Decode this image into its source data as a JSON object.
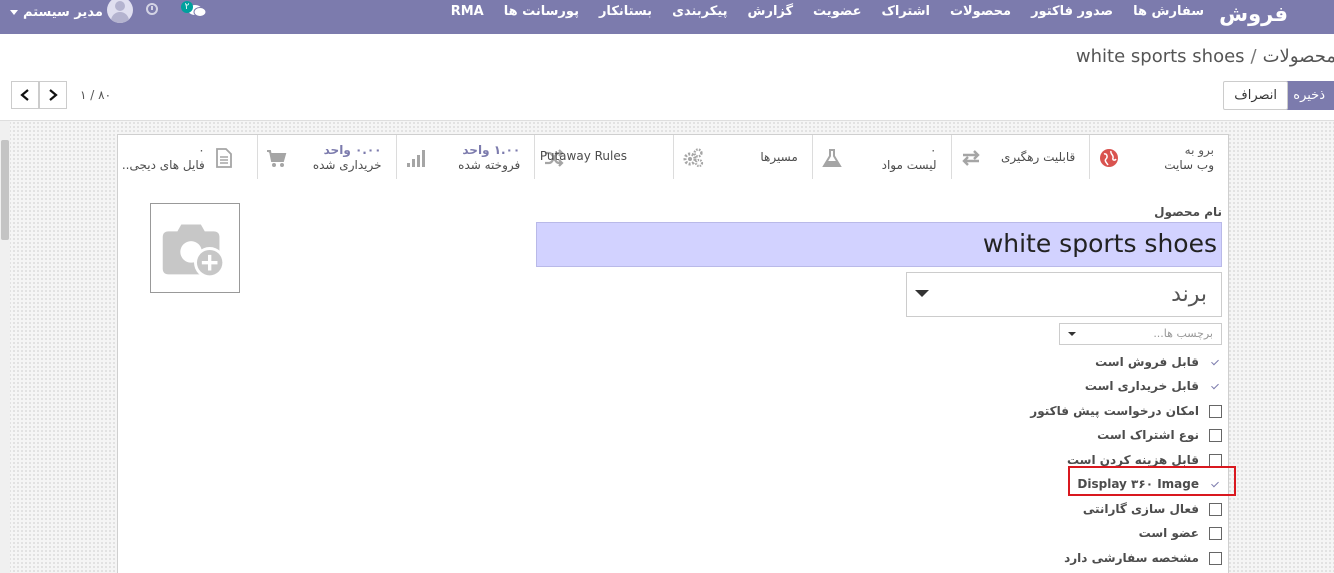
{
  "navbar": {
    "brand": "فروش",
    "menu": [
      "سفارش ها",
      "صدور فاکتور",
      "محصولات",
      "اشتراک",
      "عضویت",
      "گزارش",
      "پیکربندی",
      "بستانکار",
      "پورسانت ها",
      "RMA"
    ],
    "user_name": "مدیر سیستم",
    "chat_count": "۲",
    "bg_color": "#7c7bad"
  },
  "breadcrumb": {
    "parent": "محصولات",
    "separator": "/",
    "current": "white sports shoes"
  },
  "actions": {
    "save": "ذخیره",
    "discard": "انصراف"
  },
  "pager": {
    "value": "۱ / ۸۰"
  },
  "smart_buttons": [
    {
      "id": "website",
      "line1": "برو به",
      "line2": "وب سایت",
      "icon": "globe-icon"
    },
    {
      "id": "traceability",
      "single": "قابلیت رهگیری",
      "icon": "exchange-icon"
    },
    {
      "id": "bom",
      "line1": "۰",
      "line2": "لیست مواد",
      "icon": "flask-icon"
    },
    {
      "id": "routes",
      "single": "مسیرها",
      "icon": "cogs-icon"
    },
    {
      "id": "putaway",
      "single": "Putaway Rules",
      "icon": "random-icon"
    },
    {
      "id": "sold",
      "line1": "۱.۰۰ واحد",
      "line2": "فروخته شده",
      "icon": "signal-icon"
    },
    {
      "id": "purchased",
      "line1": "۰.۰۰ واحد",
      "line2": "خریداری شده",
      "icon": "cart-icon"
    },
    {
      "id": "files",
      "line1": "۰",
      "line2": "فایل های دیجی..",
      "icon": "file-icon"
    }
  ],
  "form": {
    "name_label": "نام محصول",
    "name_value": "white sports shoes",
    "brand_value": "برند",
    "tags_placeholder": "برچسب ها..."
  },
  "checkboxes": [
    {
      "label": "قابل فروش است",
      "checked": true
    },
    {
      "label": "قابل خریداری است",
      "checked": true
    },
    {
      "label": "امکان درخواست پیش فاکتور",
      "checked": false
    },
    {
      "label": "نوع اشتراک است",
      "checked": false
    },
    {
      "label": "قابل هزینه کردن است",
      "checked": false
    },
    {
      "label": "Display ۳۶۰ Image",
      "checked": true
    },
    {
      "label": "فعال سازی گارانتی",
      "checked": false
    },
    {
      "label": "عضو است",
      "checked": false
    },
    {
      "label": "مشخصه سفارشی دارد",
      "checked": false
    }
  ],
  "highlight_color": "#d9181f"
}
